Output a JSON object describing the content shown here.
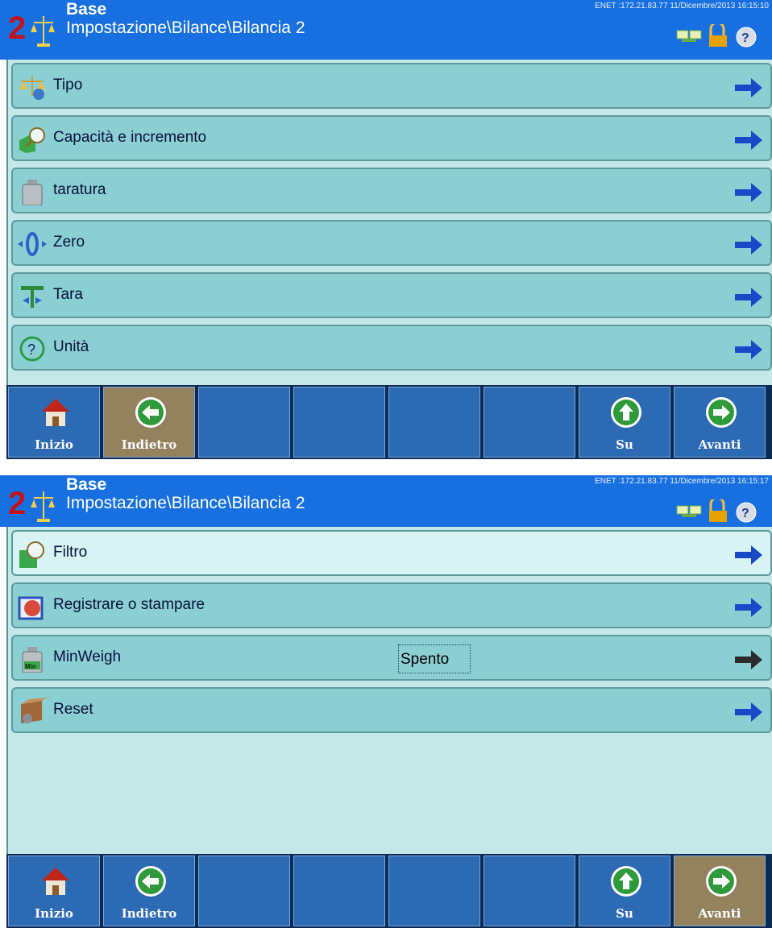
{
  "colors": {
    "header": "#1870e0",
    "item": "#8ccfd3",
    "item_selected": "#d7f3f4",
    "menu_bg": "#c4e7e8",
    "softkey": "#2d6ab4",
    "softkey_active": "#94825f",
    "arrow_blue": "#1a49c8",
    "arrow_gray": "#2b2b2b"
  },
  "screen1": {
    "header": {
      "title": "Base",
      "path": "Impostazione\\Bilance\\Bilancia 2",
      "meta": "ENET :172.21.83.77  11/Dicembre/2013 16:15:10",
      "icons": [
        "network-icon",
        "lock-icon",
        "help-icon"
      ]
    },
    "items": [
      {
        "label": "Tipo",
        "icon": "scale-icon"
      },
      {
        "label": "Capacità e incremento",
        "icon": "capacity-icon"
      },
      {
        "label": "taratura",
        "icon": "weight-icon"
      },
      {
        "label": "Zero",
        "icon": "zero-icon"
      },
      {
        "label": "Tara",
        "icon": "tare-icon"
      },
      {
        "label": "Unità",
        "icon": "unit-icon"
      }
    ],
    "softkeys": [
      {
        "label": "Inizio",
        "icon": "home-icon"
      },
      {
        "label": "Indietro",
        "icon": "back-icon",
        "active": true
      },
      {
        "label": ""
      },
      {
        "label": ""
      },
      {
        "label": ""
      },
      {
        "label": ""
      },
      {
        "label": "Su",
        "icon": "up-icon"
      },
      {
        "label": "Avanti",
        "icon": "forward-icon"
      }
    ]
  },
  "screen2": {
    "header": {
      "title": "Base",
      "path": "Impostazione\\Bilance\\Bilancia 2",
      "meta": "ENET :172.21.83.77  11/Dicembre/2013 16:15:17",
      "icons": [
        "network-icon",
        "lock-icon",
        "help-icon"
      ]
    },
    "items": [
      {
        "label": "Filtro",
        "icon": "filter-icon",
        "selected": true
      },
      {
        "label": "Registrare o stampare",
        "icon": "print-icon"
      },
      {
        "label": "MinWeigh",
        "icon": "minweigh-icon",
        "value": "Spento"
      },
      {
        "label": "Reset",
        "icon": "reset-icon"
      }
    ],
    "softkeys": [
      {
        "label": "Inizio",
        "icon": "home-icon"
      },
      {
        "label": "Indietro",
        "icon": "back-icon"
      },
      {
        "label": ""
      },
      {
        "label": ""
      },
      {
        "label": ""
      },
      {
        "label": ""
      },
      {
        "label": "Su",
        "icon": "up-icon"
      },
      {
        "label": "Avanti",
        "icon": "forward-icon",
        "active": true
      }
    ]
  }
}
